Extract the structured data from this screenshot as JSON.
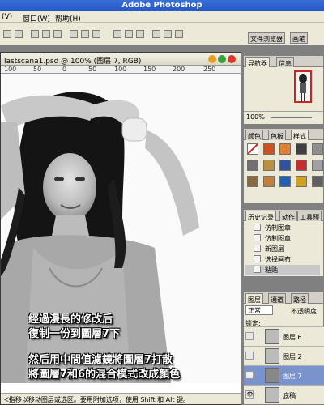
{
  "app": {
    "title": "Adobe Photoshop"
  },
  "menubar": {
    "items": [
      "(V)",
      "窗口(W)",
      "帮助(H)"
    ]
  },
  "palette_well": {
    "tabs": [
      "文件浏览器",
      "画笔"
    ]
  },
  "document": {
    "title": "lastscana1.psd @ 100% (图层 7, RGB)",
    "ruler_numbers": [
      "100",
      "50",
      "0",
      "50",
      "100",
      "150",
      "200",
      "250"
    ],
    "status": "ᐸ指移以移动图层或选区。要用附加选项，使用 Shift 和 Alt 键。"
  },
  "caption": {
    "line1": "經過漫長的修改后",
    "line2": "復制一份到圖層7下",
    "line3": "然后用中間值濾鏡將圖層7打散",
    "line4": "將圖層7和6的混合模式改成顏色"
  },
  "navigator": {
    "tabs": [
      "导航器",
      "信息"
    ],
    "zoom": "100%"
  },
  "swatches": {
    "tabs": [
      "颜色",
      "色板",
      "样式"
    ]
  },
  "history": {
    "tabs": [
      "历史记录",
      "动作",
      "工具预"
    ],
    "items": [
      {
        "label": "仿制图章",
        "selected": false
      },
      {
        "label": "仿制图章",
        "selected": false
      },
      {
        "label": "新图层",
        "selected": false
      },
      {
        "label": "选择画布",
        "selected": false
      },
      {
        "label": "粘贴",
        "selected": true
      }
    ]
  },
  "layers": {
    "tabs": [
      "图层",
      "通道",
      "路径"
    ],
    "blend_mode": "正常",
    "opacity_label": "不透明度",
    "lock_label": "锁定:",
    "items": [
      {
        "name": "图层 6",
        "selected": false
      },
      {
        "name": "图层 2",
        "selected": false
      },
      {
        "name": "图层 7",
        "selected": true
      },
      {
        "name": "底稿",
        "selected": false
      }
    ]
  }
}
